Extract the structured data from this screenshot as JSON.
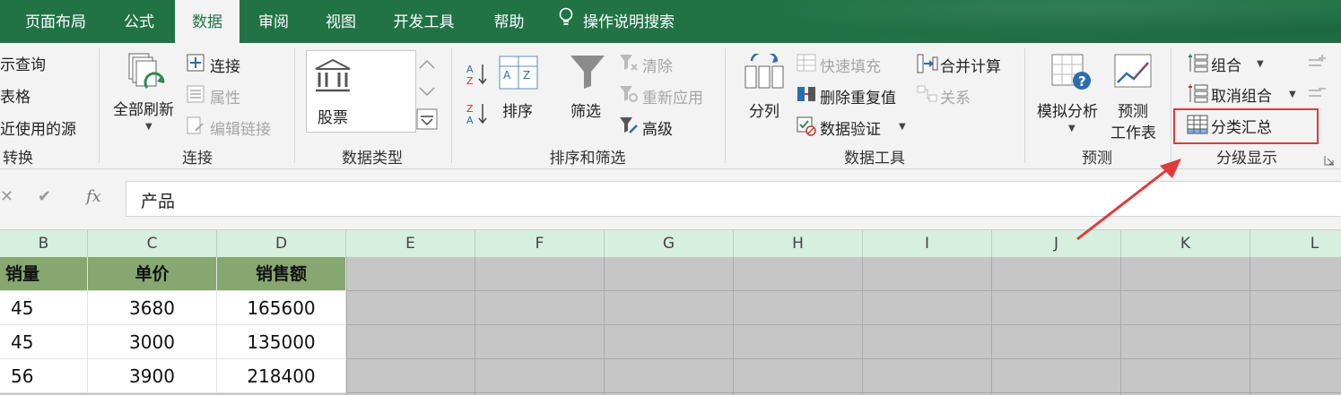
{
  "tabs": {
    "page_layout": "页面布局",
    "formulas": "公式",
    "data": "数据",
    "review": "审阅",
    "view": "视图",
    "developer": "开发工具",
    "help": "帮助",
    "search": "操作说明搜索"
  },
  "ribbon": {
    "get_transform": {
      "show_queries": "示查询",
      "from_table": "表格",
      "recent_sources": "近使用的源",
      "group_label": "转换"
    },
    "connections": {
      "refresh_all": "全部刷新",
      "connections": "连接",
      "properties": "属性",
      "edit_links": "编辑链接",
      "group_label": "连接"
    },
    "data_types": {
      "stocks": "股票",
      "group_label": "数据类型"
    },
    "sort_filter": {
      "sort": "排序",
      "filter": "筛选",
      "clear": "清除",
      "reapply": "重新应用",
      "advanced": "高级",
      "group_label": "排序和筛选"
    },
    "data_tools": {
      "text_to_columns": "分列",
      "flash_fill": "快速填充",
      "remove_duplicates": "删除重复值",
      "data_validation": "数据验证",
      "consolidate": "合并计算",
      "relationships": "关系",
      "group_label": "数据工具"
    },
    "forecast": {
      "what_if": "模拟分析",
      "forecast_sheet_1": "预测",
      "forecast_sheet_2": "工作表",
      "group_label": "预测"
    },
    "outline": {
      "group": "组合",
      "ungroup": "取消组合",
      "subtotal": "分类汇总",
      "group_label": "分级显示"
    }
  },
  "formula_bar": {
    "cancel": "✕",
    "enter": "✔",
    "fx": "fx",
    "content": "产品"
  },
  "columns": [
    "B",
    "C",
    "D",
    "E",
    "F",
    "G",
    "H",
    "I",
    "J",
    "K",
    "L"
  ],
  "table": {
    "headers": [
      "销量",
      "单价",
      "销售额"
    ],
    "rows": [
      [
        "45",
        "3680",
        "165600"
      ],
      [
        "45",
        "3000",
        "135000"
      ],
      [
        "56",
        "3900",
        "218400"
      ]
    ]
  },
  "colors": {
    "accent": "#217346",
    "header_fill": "#86a770",
    "highlight": "#e03a3a"
  }
}
